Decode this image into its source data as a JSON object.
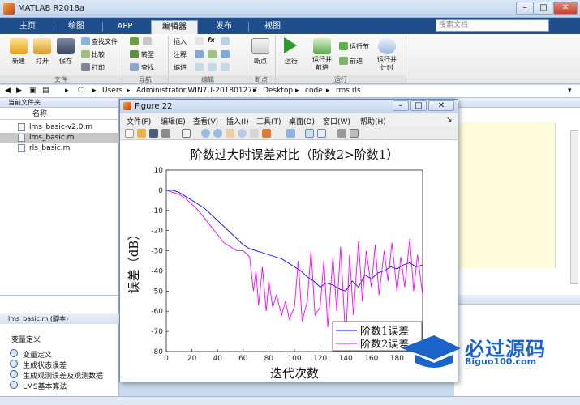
{
  "window": {
    "title": "MATLAB R2018a"
  },
  "tabs": [
    {
      "label": "主页"
    },
    {
      "label": "绘图"
    },
    {
      "label": "APP"
    },
    {
      "label": "编辑器"
    },
    {
      "label": "发布"
    },
    {
      "label": "视图"
    }
  ],
  "search": {
    "placeholder": "搜索文档"
  },
  "ribbon": {
    "file": {
      "new": "新建",
      "open": "打开",
      "save": "保存",
      "find_file": "查找文件",
      "compare": "比较",
      "print": "打印",
      "group": "文件"
    },
    "nav": {
      "goto": "转至",
      "find": "查找",
      "group": "导航"
    },
    "edit": {
      "insert": "插入",
      "fx": "fx",
      "comment": "注释",
      "indent": "缩进",
      "group": "编辑"
    },
    "breakpoint": {
      "label": "断点",
      "group": "断点"
    },
    "run": {
      "run": "运行",
      "run_advance_1": "运行并",
      "run_advance_2": "前进",
      "run_section": "运行节",
      "advance": "前进",
      "run_time_1": "运行并",
      "run_time_2": "计时",
      "group": "运行"
    }
  },
  "path": {
    "crumbs": [
      "C:",
      "Users",
      "Administrator.WIN7U-20180127Z",
      "Desktop",
      "code",
      "rms rls"
    ]
  },
  "left_panel": {
    "header": "当前文件夹",
    "col_name": "名称",
    "files": [
      {
        "name": "lms_basic-v2.0.m",
        "selected": false
      },
      {
        "name": "lms_basic.m",
        "selected": true
      },
      {
        "name": "rls_basic.m",
        "selected": false
      }
    ],
    "details_title": "lms_basic.m  (脚本)",
    "details_heading": "变量定义",
    "details_items": [
      "变量定义",
      "生成状态误差",
      "生成观测误差及观测数据",
      "LMS基本算法"
    ]
  },
  "figure": {
    "title": "Figure 22",
    "menu": [
      "文件(F)",
      "编辑(E)",
      "查看(V)",
      "插入(I)",
      "工具(T)",
      "桌面(D)",
      "窗口(W)",
      "帮助(H)"
    ]
  },
  "chart_data": {
    "type": "line",
    "title": "阶数过大时误差对比（阶数2>阶数1）",
    "xlabel": "迭代次数",
    "ylabel": "误差（dB）",
    "xlim": [
      0,
      200
    ],
    "ylim": [
      -80,
      10
    ],
    "xticks": [
      0,
      20,
      40,
      60,
      80,
      100,
      120,
      140,
      160,
      180
    ],
    "yticks": [
      10,
      0,
      -10,
      -20,
      -30,
      -40,
      -50,
      -60,
      -70,
      -80
    ],
    "grid": false,
    "legend_position": "bottom-right",
    "series": [
      {
        "name": "阶数1误差",
        "color": "#0000ff",
        "x": [
          0,
          5,
          10,
          15,
          20,
          25,
          30,
          35,
          40,
          45,
          50,
          55,
          60,
          65,
          70,
          75,
          80,
          85,
          90,
          95,
          100,
          105,
          110,
          115,
          120,
          125,
          130,
          135,
          140,
          145,
          150,
          155,
          160,
          165,
          170,
          175,
          180,
          185,
          190,
          195,
          200
        ],
        "y": [
          0,
          0,
          -1,
          -3,
          -5,
          -7,
          -9,
          -12,
          -15,
          -18,
          -21,
          -24,
          -27,
          -29,
          -30,
          -31,
          -32,
          -33,
          -34,
          -36,
          -38,
          -40,
          -43,
          -45,
          -48,
          -46,
          -47,
          -49,
          -50,
          -45,
          -48,
          -42,
          -44,
          -41,
          -40,
          -38,
          -39,
          -37,
          -36,
          -38,
          -37
        ]
      },
      {
        "name": "阶数2误差",
        "color": "#ff00ff",
        "x": [
          0,
          5,
          10,
          15,
          20,
          25,
          30,
          35,
          40,
          45,
          50,
          55,
          60,
          65,
          68,
          70,
          72,
          75,
          78,
          80,
          83,
          86,
          90,
          93,
          96,
          100,
          103,
          106,
          110,
          113,
          116,
          120,
          123,
          126,
          130,
          133,
          136,
          140,
          143,
          146,
          150,
          153,
          156,
          160,
          163,
          166,
          170,
          173,
          176,
          180,
          183,
          186,
          190,
          193,
          196,
          200
        ],
        "y": [
          0,
          -1,
          -2,
          -4,
          -7,
          -10,
          -14,
          -18,
          -22,
          -26,
          -28,
          -30,
          -30,
          -33,
          -50,
          -40,
          -57,
          -38,
          -60,
          -45,
          -58,
          -52,
          -62,
          -55,
          -64,
          -58,
          -35,
          -65,
          -55,
          -30,
          -62,
          -58,
          -35,
          -68,
          -33,
          -60,
          -28,
          -75,
          -32,
          -62,
          -25,
          -55,
          -30,
          -48,
          -27,
          -52,
          -30,
          -45,
          -26,
          -50,
          -33,
          -48,
          -24,
          -50,
          -32,
          -52
        ]
      }
    ]
  },
  "watermark": {
    "text": "必过源码",
    "url": "Biguo100.com"
  }
}
